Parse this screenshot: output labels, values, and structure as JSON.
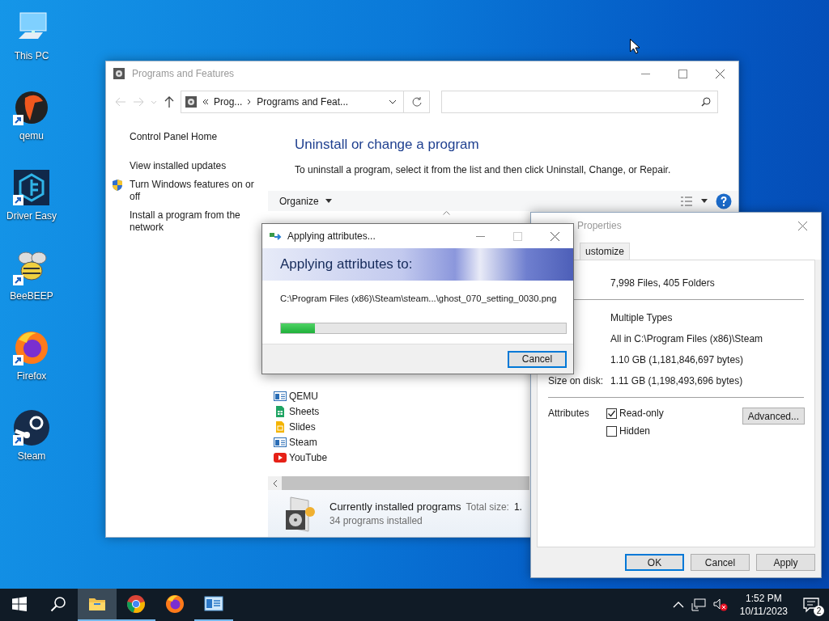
{
  "desktop_icons": [
    {
      "label": "This PC",
      "kind": "pc",
      "shortcut": false
    },
    {
      "label": "qemu",
      "kind": "qemu",
      "shortcut": true
    },
    {
      "label": "Driver Easy",
      "kind": "drivereasy",
      "shortcut": true
    },
    {
      "label": "BeeBEEP",
      "kind": "bee",
      "shortcut": true
    },
    {
      "label": "Firefox",
      "kind": "firefox",
      "shortcut": true
    },
    {
      "label": "Steam",
      "kind": "steam",
      "shortcut": true
    }
  ],
  "programs_window": {
    "title": "Programs and Features",
    "breadcrumb": [
      "Prog...",
      "Programs and Feat..."
    ],
    "sidebar": [
      {
        "label": "Control Panel Home",
        "shield": false
      },
      {
        "label": "View installed updates",
        "shield": false
      },
      {
        "label": "Turn Windows features on or off",
        "shield": true
      },
      {
        "label": "Install a program from the network",
        "shield": false
      }
    ],
    "heading": "Uninstall or change a program",
    "description": "To uninstall a program, select it from the list and then click Uninstall, Change, or Repair.",
    "organize": "Organize",
    "programs": [
      {
        "name": "QEMU",
        "kind": "app"
      },
      {
        "name": "Sheets",
        "kind": "sheets"
      },
      {
        "name": "Slides",
        "kind": "slides"
      },
      {
        "name": "Steam",
        "kind": "app"
      },
      {
        "name": "YouTube",
        "kind": "youtube"
      }
    ],
    "status": {
      "title": "Currently installed programs",
      "total_label": "Total size:",
      "total_value": "1.",
      "count": "34 programs installed"
    }
  },
  "properties_window": {
    "title": "Properties",
    "tabs": [
      {
        "label": "ustomize",
        "selected": false
      }
    ],
    "groups": [
      [
        {
          "value": "7,998 Files, 405 Folders"
        }
      ],
      [
        {
          "value": "Multiple Types"
        },
        {
          "value": "All in C:\\Program Files (x86)\\Steam"
        },
        {
          "value": "1.10 GB (1,181,846,697 bytes)"
        },
        {
          "label": "Size on disk:",
          "value": "1.11 GB (1,198,493,696 bytes)"
        }
      ]
    ],
    "attributes": {
      "label": "Attributes",
      "checkboxes": [
        {
          "label": "Read-only",
          "checked": true
        },
        {
          "label": "Hidden",
          "checked": false
        }
      ],
      "advanced": "Advanced..."
    },
    "buttons": [
      {
        "label": "OK",
        "default": true
      },
      {
        "label": "Cancel",
        "default": false
      },
      {
        "label": "Apply",
        "default": false
      }
    ]
  },
  "progress_dialog": {
    "title": "Applying attributes...",
    "header": "Applying attributes to:",
    "path": "C:\\Program Files (x86)\\Steam\\steam...\\ghost_070_setting_0030.png",
    "level": 0.12,
    "button": "Cancel"
  },
  "taskbar": {
    "apps": [
      {
        "kind": "explorer",
        "active": true,
        "running": true
      },
      {
        "kind": "chrome",
        "active": false,
        "running": true
      },
      {
        "kind": "firefox",
        "active": false,
        "running": false
      },
      {
        "kind": "control",
        "active": false,
        "running": true
      }
    ],
    "time": "1:52 PM",
    "date": "10/11/2023",
    "notifications": "2"
  }
}
